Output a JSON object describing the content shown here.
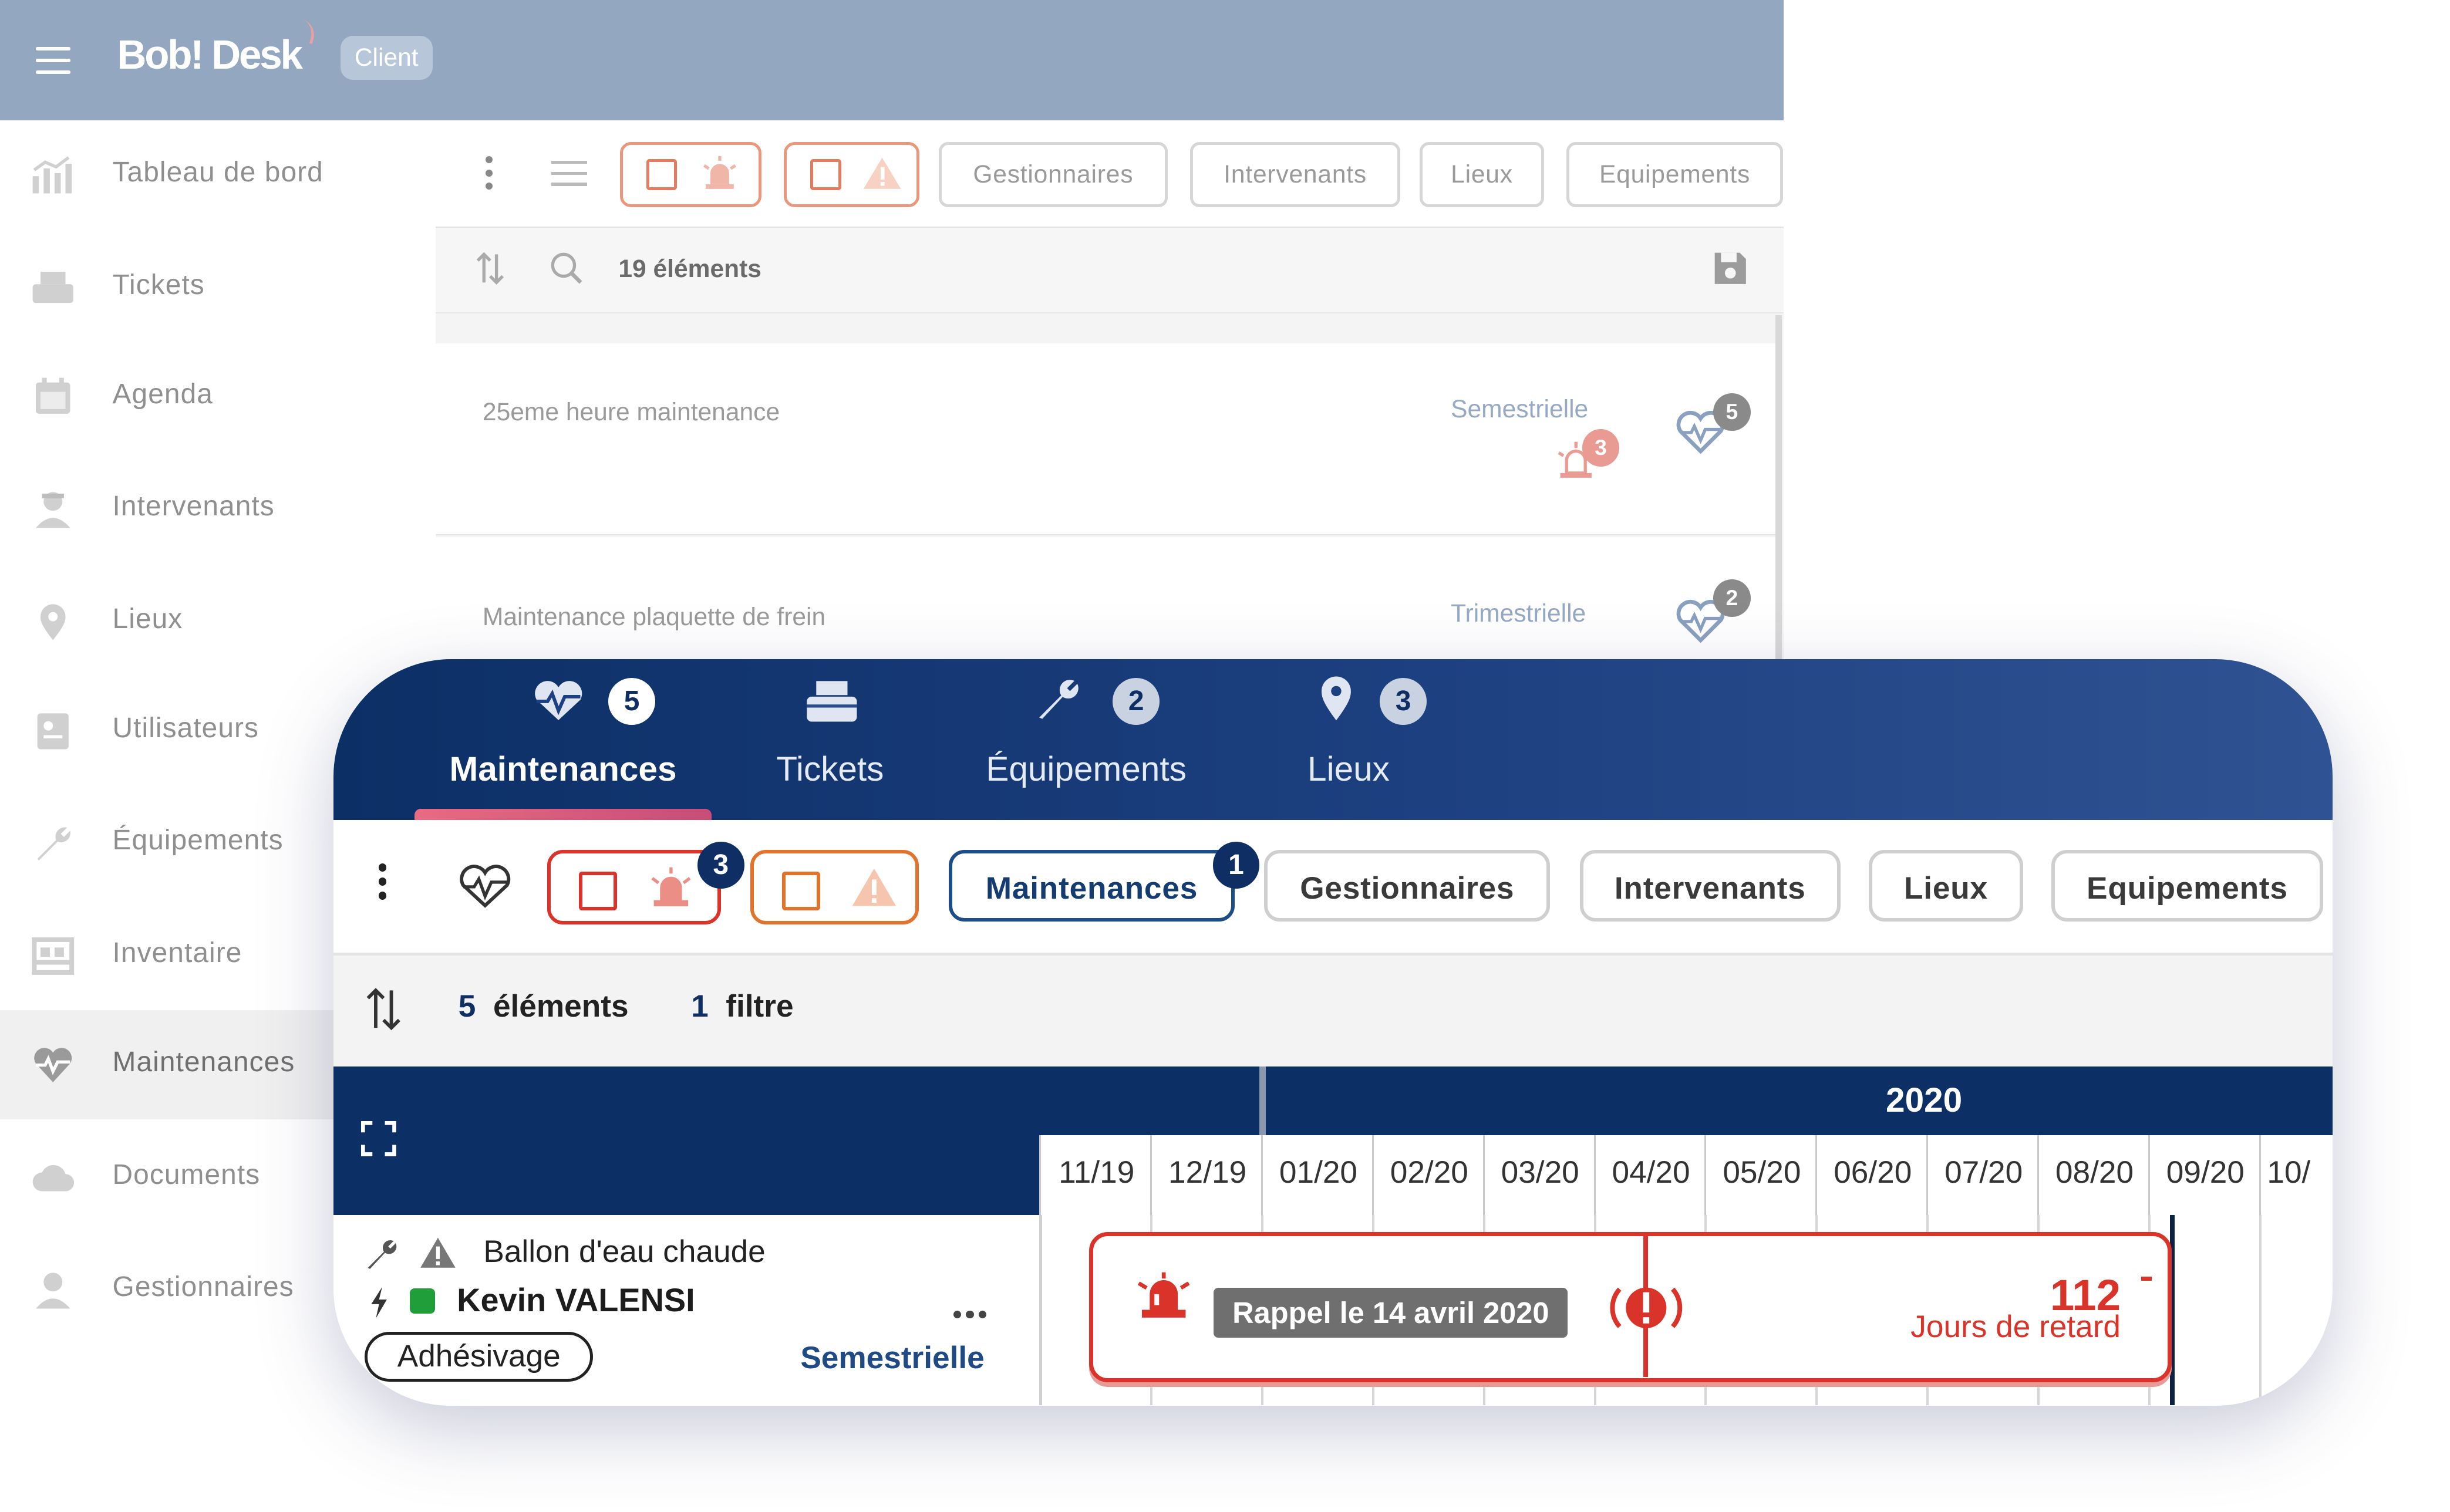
{
  "app": {
    "logo": "Bob! Desk",
    "role_badge": "Client"
  },
  "sidebar": {
    "items": [
      {
        "label": "Tableau de bord",
        "icon": "chart-icon"
      },
      {
        "label": "Tickets",
        "icon": "printer-icon"
      },
      {
        "label": "Agenda",
        "icon": "calendar-icon"
      },
      {
        "label": "Intervenants",
        "icon": "worker-icon"
      },
      {
        "label": "Lieux",
        "icon": "map-pin-icon"
      },
      {
        "label": "Utilisateurs",
        "icon": "id-card-icon"
      },
      {
        "label": "Équipements",
        "icon": "wrench-icon"
      },
      {
        "label": "Inventaire",
        "icon": "inventory-icon"
      },
      {
        "label": "Maintenances",
        "icon": "heartbeat-icon",
        "active": true
      },
      {
        "label": "Documents",
        "icon": "cloud-icon"
      },
      {
        "label": "Gestionnaires",
        "icon": "manager-icon"
      }
    ]
  },
  "background_list": {
    "filters": [
      "Gestionnaires",
      "Intervenants",
      "Lieux",
      "Equipements"
    ],
    "count_label": "19 éléments",
    "rows": [
      {
        "name": "25eme heure maintenance",
        "frequency": "Semestrielle",
        "alarm_count": "3",
        "heart_count": "5"
      },
      {
        "name": "Maintenance plaquette de frein",
        "frequency": "Trimestrielle",
        "heart_count": "2"
      }
    ]
  },
  "card": {
    "tabs": [
      {
        "label": "Maintenances",
        "badge": "5",
        "icon": "heartbeat-icon",
        "active": true
      },
      {
        "label": "Tickets",
        "icon": "printer-icon"
      },
      {
        "label": "Équipements",
        "badge": "2",
        "icon": "wrench-icon"
      },
      {
        "label": "Lieux",
        "badge": "3",
        "icon": "map-pin-icon"
      }
    ],
    "toolbar": {
      "alarm_filter_badge": "3",
      "maintenances_label": "Maintenances",
      "maintenances_badge": "1",
      "filters": [
        "Gestionnaires",
        "Intervenants",
        "Lieux",
        "Equipements"
      ]
    },
    "summary": {
      "count": "5",
      "count_label": "éléments",
      "filters": "1",
      "filters_label": "filtre"
    },
    "gantt": {
      "year": "2020",
      "months": [
        "11/19",
        "12/19",
        "01/20",
        "02/20",
        "03/20",
        "04/20",
        "05/20",
        "06/20",
        "07/20",
        "08/20",
        "09/20",
        "10/"
      ],
      "row": {
        "equipment": "Ballon d'eau chaude",
        "technician": "Kevin VALENSI",
        "technician_status_color": "#1f9e3a",
        "tag": "Adhésivage",
        "frequency": "Semestrielle",
        "reminder": "Rappel le 14 avril 2020",
        "delay_days": "112",
        "delay_label": "Jours de retard",
        "delay_dash": "-"
      }
    }
  },
  "colors": {
    "navy": "#0c2f66",
    "alert_red": "#d9332a",
    "alert_orange": "#e2732d",
    "topbar": "#93a7c1"
  }
}
